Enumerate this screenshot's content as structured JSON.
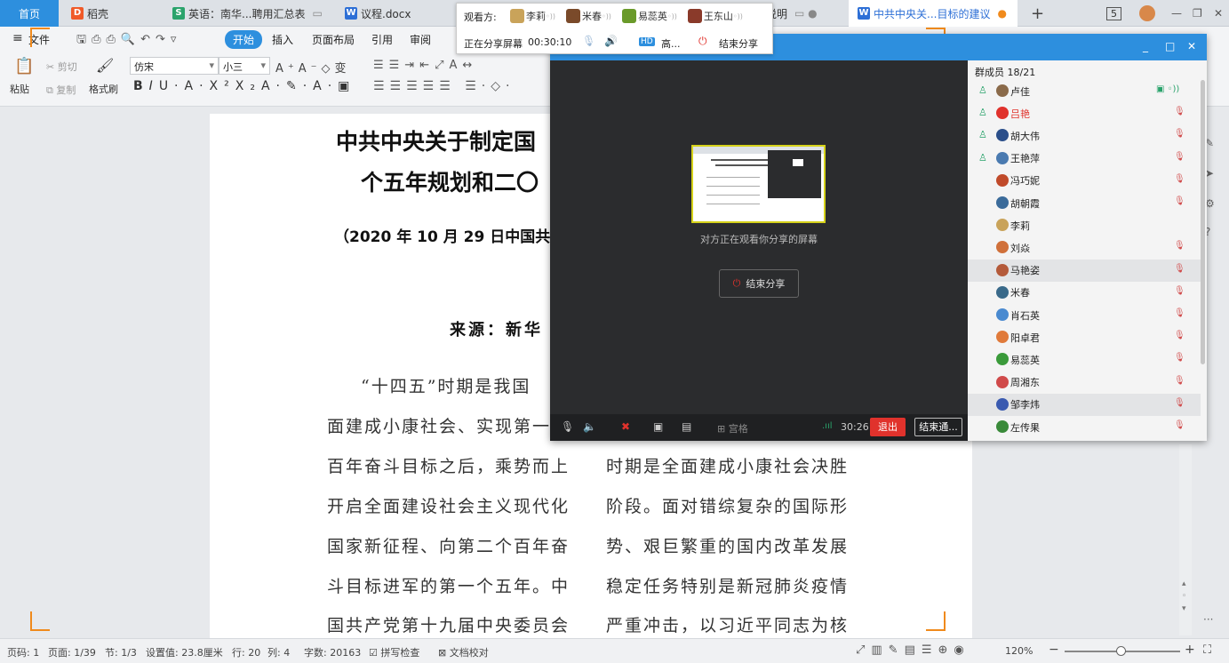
{
  "tabs": [
    {
      "label": "首页",
      "active": true
    },
    {
      "label": "稻壳",
      "icon": "daoke-icon"
    },
    {
      "label": "英语：南华...聘用汇总表",
      "icon": "sheet-icon"
    },
    {
      "label": "议程.docx",
      "icon": "word-icon"
    },
    {
      "label": "说明"
    },
    {
      "label": "中共中央关...目标的建议",
      "icon": "word-icon"
    }
  ],
  "window_controls": {
    "page_badge": "5"
  },
  "menu": [
    "文件",
    "开始",
    "插入",
    "页面布局",
    "引用",
    "审阅"
  ],
  "ribbon": {
    "paste": "粘贴",
    "cut": "剪切",
    "copy": "复制",
    "format_painter": "格式刷",
    "font_name": "仿宋",
    "font_size": "小三"
  },
  "document": {
    "title_line1": "中共中央关于制定国",
    "title_line2": "个五年规划和二〇",
    "date_line": "（2020 年 10 月 29 日中国共",
    "source": "来源：新华",
    "left_col": [
      "“十四五”时期是我国",
      "面建成小康社会、实现第一",
      "百年奋斗目标之后，乘势而上",
      "开启全面建设社会主义现代化",
      "国家新征程、向第二个百年奋",
      "斗目标进军的第一个五年。中",
      "国共产党第十九届中央委员会"
    ],
    "right_col": [
      "时期是全面建成小康社会决胜",
      "阶段。面对错综复杂的国际形",
      "势、艰巨繁重的国内改革发展",
      "稳定任务特别是新冠肺炎疫情",
      "严重冲击，以习近平同志为核"
    ]
  },
  "viewer_popup": {
    "label": "观看方:",
    "viewers": [
      "李莉",
      "米春",
      "易蕊英",
      "王东山"
    ],
    "sharing_label": "正在分享屏幕",
    "timer": "00:30:10",
    "hd_badge": "HD",
    "hd_label": "高...",
    "end_label": "结束分享"
  },
  "share_window": {
    "preview_caption": "对方正在观看你分享的屏幕",
    "end_share_button": "结束分享",
    "toolbar": {
      "grid_label": "宫格",
      "time": "30:26",
      "exit_label": "退出",
      "end_meeting_label": "结束通..."
    },
    "members_header": "群成员 18/21",
    "members": [
      {
        "name": "卢佳",
        "host": true,
        "color": "#222",
        "status": "sharing"
      },
      {
        "name": "吕艳",
        "host": true,
        "color": "#e0322c",
        "status": "muted"
      },
      {
        "name": "胡大伟",
        "host": true,
        "color": "#222",
        "status": "muted"
      },
      {
        "name": "王艳萍",
        "host": true,
        "color": "#222",
        "status": "muted"
      },
      {
        "name": "冯巧妮",
        "host": false,
        "color": "#222",
        "status": "muted"
      },
      {
        "name": "胡朝霞",
        "host": false,
        "color": "#222",
        "status": "muted"
      },
      {
        "name": "李莉",
        "host": false,
        "color": "#222",
        "status": "none"
      },
      {
        "name": "刘焱",
        "host": false,
        "color": "#222",
        "status": "muted"
      },
      {
        "name": "马艳姿",
        "host": false,
        "color": "#222",
        "status": "muted"
      },
      {
        "name": "米春",
        "host": false,
        "color": "#222",
        "status": "muted"
      },
      {
        "name": "肖石英",
        "host": false,
        "color": "#222",
        "status": "muted"
      },
      {
        "name": "阳卓君",
        "host": false,
        "color": "#222",
        "status": "muted"
      },
      {
        "name": "易蕊英",
        "host": false,
        "color": "#222",
        "status": "muted"
      },
      {
        "name": "周湘东",
        "host": false,
        "color": "#222",
        "status": "muted"
      },
      {
        "name": "邹李炜",
        "host": false,
        "color": "#222",
        "status": "muted"
      },
      {
        "name": "左传果",
        "host": false,
        "color": "#222",
        "status": "muted"
      }
    ]
  },
  "statusbar": {
    "page_no": "页码: 1",
    "page": "页面: 1/39",
    "section": "节: 1/3",
    "setting": "设置值: 23.8厘米",
    "row": "行: 20",
    "col": "列: 4",
    "words": "字数: 20163",
    "spell": "拼写检查",
    "proof": "文档校对",
    "zoom": "120%"
  },
  "colors": {
    "accent": "#2d8fde",
    "exit": "#e0322c",
    "frame": "#f08a1c",
    "preview_border": "#d6d21a"
  }
}
